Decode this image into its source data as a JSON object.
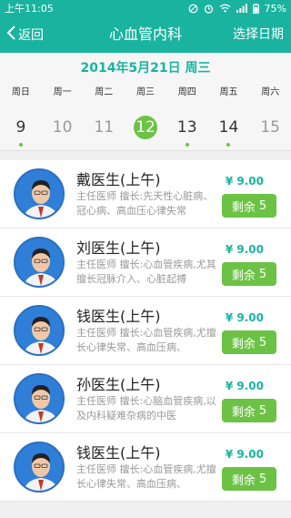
{
  "statusbar": {
    "time": "上午11:05",
    "battery": "75%"
  },
  "navbar": {
    "back_label": "返回",
    "title": "心血管内科",
    "right_label": "选择日期"
  },
  "calendar": {
    "title": "2014年5月21日  周三",
    "weekdays": [
      "周日",
      "周一",
      "周二",
      "周三",
      "周四",
      "周五",
      "周六"
    ],
    "days": [
      {
        "num": "9",
        "dot": true,
        "dim": false,
        "selected": false
      },
      {
        "num": "10",
        "dot": false,
        "dim": true,
        "selected": false
      },
      {
        "num": "11",
        "dot": false,
        "dim": true,
        "selected": false
      },
      {
        "num": "12",
        "dot": false,
        "dim": false,
        "selected": true
      },
      {
        "num": "13",
        "dot": true,
        "dim": false,
        "selected": false
      },
      {
        "num": "14",
        "dot": true,
        "dim": false,
        "selected": false
      },
      {
        "num": "15",
        "dot": false,
        "dim": true,
        "selected": false
      }
    ]
  },
  "doctors": [
    {
      "name": "戴医生(上午)",
      "desc": "主任医师  擅长:先天性心脏病、冠心病、高血压心律失常",
      "price": "¥ 9.00",
      "remain_label": "剩余",
      "remain_count": "5"
    },
    {
      "name": "刘医生(上午)",
      "desc": "主任医师  擅长:心血管疾病,尤其擅长冠脉介入、心脏起搏",
      "price": "¥ 9.00",
      "remain_label": "剩余",
      "remain_count": "5"
    },
    {
      "name": "钱医生(上午)",
      "desc": "主任医师  擅长:心血管疾病,尤擅长心律失常、高血压病、",
      "price": "¥ 9.00",
      "remain_label": "剩余",
      "remain_count": "5"
    },
    {
      "name": "孙医生(上午)",
      "desc": "主任医师  擅长:心脑血管疾病,以及内科疑难杂病的中医",
      "price": "¥ 9.00",
      "remain_label": "剩余",
      "remain_count": "5"
    },
    {
      "name": "钱医生(上午)",
      "desc": "主任医师  擅长:心血管疾病,尤擅长心律失常、高血压病、",
      "price": "¥ 9.00",
      "remain_label": "剩余",
      "remain_count": "5"
    }
  ],
  "colors": {
    "primary": "#1ab3a0",
    "accent_green": "#6cc244",
    "avatar_bg": "#2f7fd8"
  },
  "icons": {
    "back": "chevron-left-icon",
    "mute": "mute-icon",
    "alarm": "alarm-icon",
    "wifi": "wifi-icon",
    "signal": "signal-icon",
    "battery": "battery-icon"
  }
}
